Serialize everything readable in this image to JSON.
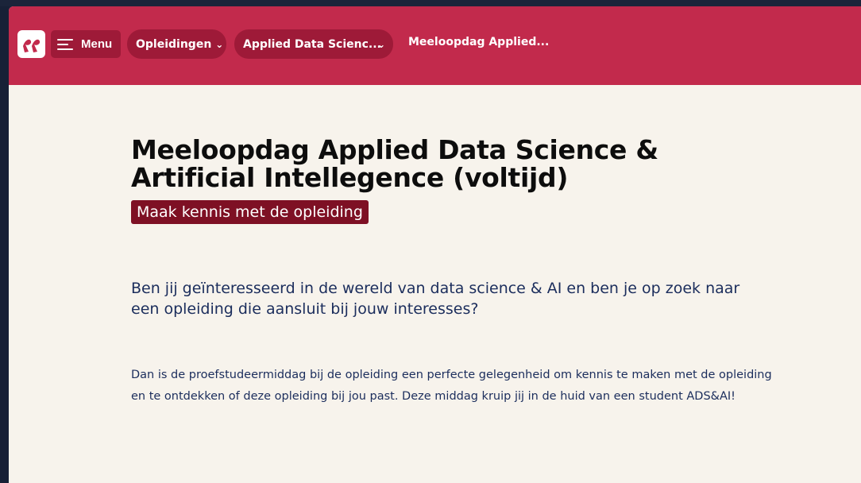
{
  "header": {
    "logo_icon": "hogeschool-logo-icon",
    "menu_label": "Menu",
    "menu_icon": "hamburger-icon",
    "breadcrumbs": [
      {
        "label": "Opleidingen",
        "icon": "chevron-down-icon"
      },
      {
        "label": "Applied Data Scienc...",
        "icon": "chevron-down-icon"
      },
      {
        "label": "Meeloopdag Applied..."
      }
    ],
    "accent_color": "#c22a4c",
    "pill_color": "#9e1a38"
  },
  "main": {
    "title": "Meeloopdag Applied Data Science & Artificial Intellegence (voltijd)",
    "subtitle": "Maak kennis met de opleiding",
    "intro": "Ben jij geïnteresseerd in de wereld van data science & AI en ben je op zoek naar een opleiding die aansluit bij jouw interesses?",
    "body": "Dan is de proefstudeermiddag bij de opleiding een perfecte gelegenheid om kennis te maken met de opleiding en te ontdekken of deze opleiding bij jou past. Deze middag kruip jij in de huid van een student ADS&AI!",
    "subtitle_color": "#7e1024",
    "text_color": "#1b2d5c",
    "background_color": "#f7f3ec"
  }
}
